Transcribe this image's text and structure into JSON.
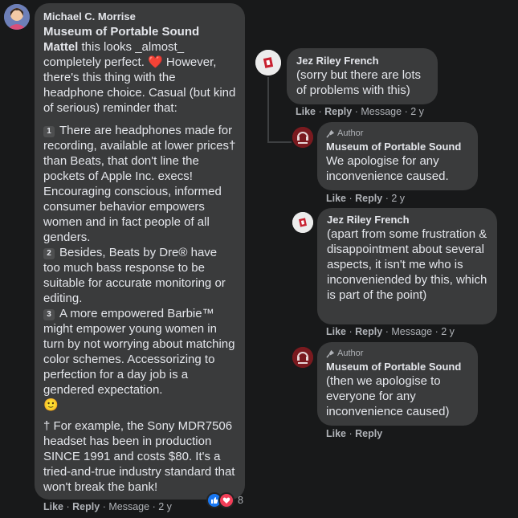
{
  "colors": {
    "background": "#18191a",
    "bubble": "#3a3b3c",
    "text": "#e4e6eb",
    "muted": "#b0b3b8",
    "like": "#1877f2",
    "love": "#f33e58",
    "heart": "#e0245e"
  },
  "main_comment": {
    "author": "Michael C. Morrise",
    "tag": "Museum of Portable Sound Mattel",
    "intro": " this looks _almost_ completely perfect. ",
    "intro_heart": "❤️",
    "intro_rest": " However, there's this thing with the headphone choice. Casual (but kind of serious) reminder that:",
    "points": [
      {
        "num": "1",
        "text": "There are headphones made for recording, available at lower prices† than Beats, that don't line the pockets of Apple Inc. execs! Encouraging conscious, informed consumer behavior empowers women and in fact people of all genders."
      },
      {
        "num": "2",
        "text": "Besides, Beats by Dre® have too much bass response to be suitable for accurate monitoring or editing."
      },
      {
        "num": "3",
        "text": "A more empowered Barbie™ might empower young women in turn by not worrying about matching color schemes. Accessorizing to perfection for a day job is a gendered expectation."
      }
    ],
    "points_emoji": "🙂",
    "footnote": "† For example, the Sony MDR7506 headset has been in production SINCE 1991 and costs $80. It's a tried-and-true industry standard that won't break the bank!",
    "actions": {
      "like": "Like",
      "reply": "Reply",
      "message": "Message",
      "time": "2 y"
    },
    "reaction_count": "8"
  },
  "replies": [
    {
      "author": "Jez Riley French",
      "text": "(sorry but there are lots of problems with this)",
      "actions": {
        "like": "Like",
        "reply": "Reply",
        "message": "Message",
        "time": "2 y"
      }
    },
    {
      "author_label": "Author",
      "author": "Museum of Portable Sound",
      "text": "We apologise for any inconvenience caused.",
      "actions": {
        "like": "Like",
        "reply": "Reply",
        "time": "2 y"
      }
    },
    {
      "author": "Jez Riley French",
      "text": "(apart from some frustration & disappointment about several aspects, it isn't me who is inconveniended by this, which is part of the point)",
      "actions": {
        "like": "Like",
        "reply": "Reply",
        "message": "Message",
        "time": "2 y"
      }
    },
    {
      "author_label": "Author",
      "author": "Museum of Portable Sound",
      "text": "(then we apologise to everyone for any inconvenience caused)",
      "actions": {
        "like": "Like",
        "reply": "Reply"
      }
    }
  ],
  "separator": "·"
}
